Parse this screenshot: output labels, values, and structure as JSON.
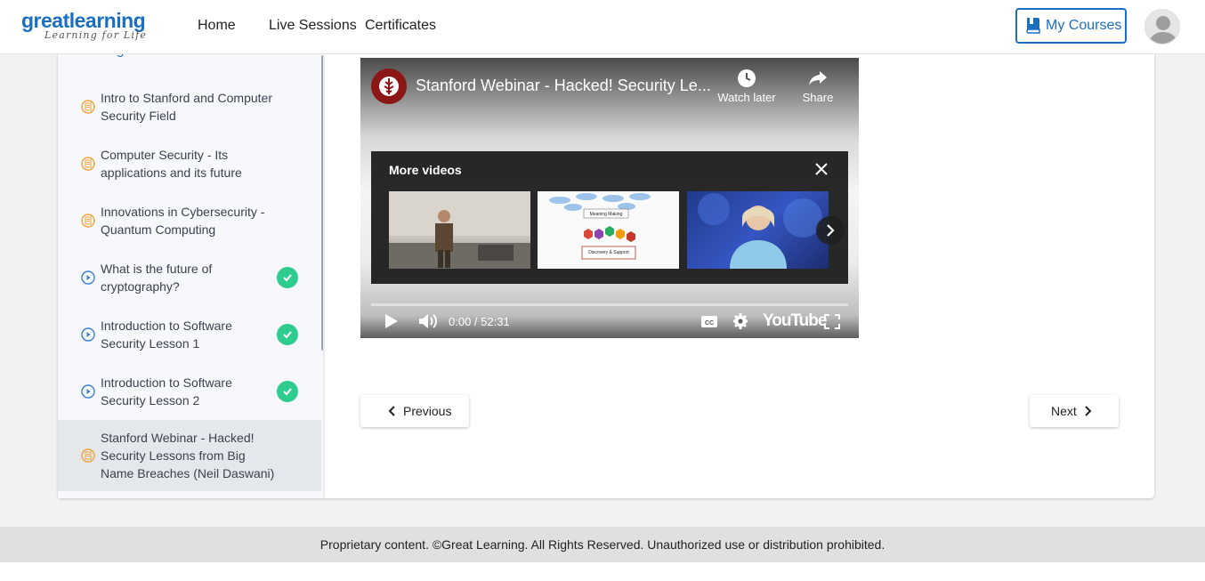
{
  "header": {
    "logo_main": "greatlearning",
    "logo_sub": "Learning for Life",
    "nav": [
      "Home",
      "Live Sessions",
      "Certificates"
    ],
    "my_courses_label": "My Courses",
    "accent_color": "#1b6fc1"
  },
  "sidebar": {
    "heading": "Learning Material",
    "items": [
      {
        "label": "Intro to Stanford and Computer Security Field",
        "type": "document-icon",
        "completed": false
      },
      {
        "label": "Computer Security - Its applications and its future",
        "type": "document-icon",
        "completed": false
      },
      {
        "label": "Innovations in Cybersecurity - Quantum Computing",
        "type": "document-icon",
        "completed": false
      },
      {
        "label": "What is the future of cryptography?",
        "type": "play-icon",
        "completed": true
      },
      {
        "label": "Introduction to Software Security Lesson 1",
        "type": "play-icon",
        "completed": true
      },
      {
        "label": "Introduction to Software Security Lesson 2",
        "type": "play-icon",
        "completed": true
      },
      {
        "label": "Stanford Webinar - Hacked! Security Lessons from Big Name Breaches (Neil Daswani)",
        "type": "document-icon",
        "completed": false,
        "active": true
      }
    ]
  },
  "video": {
    "title": "Stanford Webinar - Hacked! Security Le...",
    "watch_later": "Watch later",
    "share": "Share",
    "more_videos_title": "More videos",
    "time": "0:00 / 52:31",
    "youtube_label": "YouTube",
    "thumb2_text1": "Meaning Making",
    "thumb2_text2": "Discovery & Support",
    "progress": 0
  },
  "pager": {
    "previous": "Previous",
    "next": "Next"
  },
  "footer": {
    "text": "Proprietary content. ©Great Learning. All Rights Reserved. Unauthorized use or distribution prohibited."
  }
}
